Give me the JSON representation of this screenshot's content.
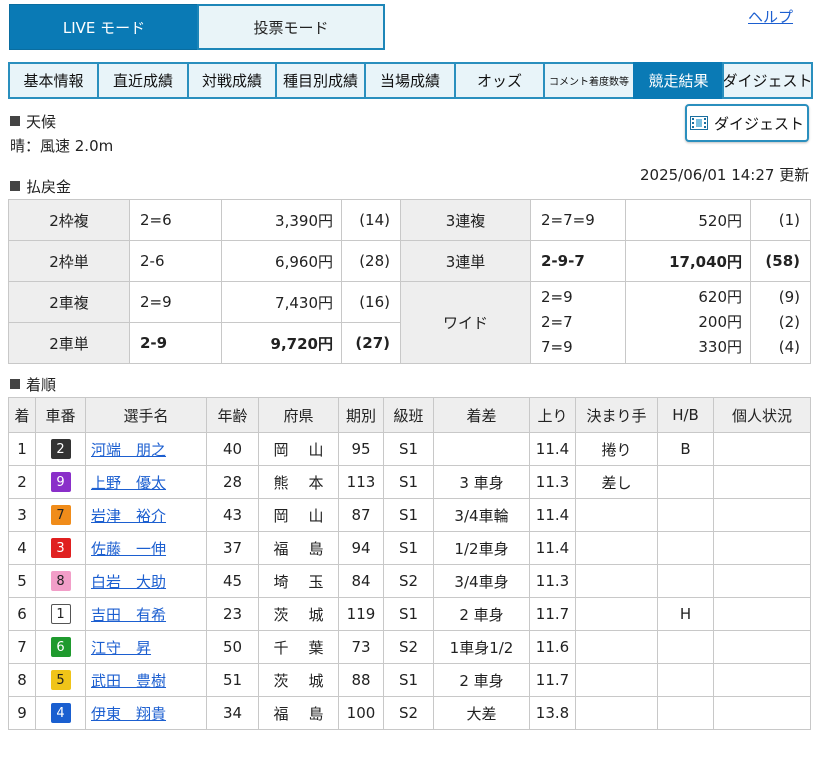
{
  "mode_tabs": {
    "live": "LIVE モード",
    "vote": "投票モード"
  },
  "help": "ヘルプ",
  "nav_tabs": [
    "基本情報",
    "直近成績",
    "対戦成績",
    "種目別成績",
    "当場成績",
    "オッズ",
    "コメント着度数等",
    "競走結果",
    "ダイジェスト"
  ],
  "weather": {
    "title": "天候",
    "text": "晴：風速 2.0m"
  },
  "digest_button": "ダイジェスト",
  "updated": "2025/06/01 14:27 更新",
  "payout": {
    "title": "払戻金",
    "left": [
      {
        "label": "2枠複",
        "combo": "2=6",
        "amount": "3,390円",
        "pop": "(14)"
      },
      {
        "label": "2枠単",
        "combo": "2-6",
        "amount": "6,960円",
        "pop": "(28)"
      },
      {
        "label": "2車複",
        "combo": "2=9",
        "amount": "7,430円",
        "pop": "(16)"
      },
      {
        "label": "2車単",
        "combo": "2-9",
        "amount": "9,720円",
        "pop": "(27)"
      }
    ],
    "right": [
      {
        "label": "3連複",
        "combo": "2=7=9",
        "amount": "520円",
        "pop": "(1)"
      },
      {
        "label": "3連単",
        "combo": "2-9-7",
        "amount": "17,040円",
        "pop": "(58)"
      }
    ],
    "wide": {
      "label": "ワイド",
      "rows": [
        {
          "combo": "2=9",
          "amount": "620円",
          "pop": "(9)"
        },
        {
          "combo": "2=7",
          "amount": "200円",
          "pop": "(2)"
        },
        {
          "combo": "7=9",
          "amount": "330円",
          "pop": "(4)"
        }
      ]
    }
  },
  "results": {
    "title": "着順",
    "headers": [
      "着",
      "車番",
      "選手名",
      "年齢",
      "府県",
      "期別",
      "級班",
      "着差",
      "上り",
      "決まり手",
      "H/B",
      "個人状況"
    ],
    "rows": [
      {
        "rank": "1",
        "car": "2",
        "name": "河端　朋之",
        "age": "40",
        "pref": "岡山",
        "term": "95",
        "class": "S1",
        "margin": "",
        "last": "11.4",
        "kimarite": "捲り",
        "hb": "B",
        "status": ""
      },
      {
        "rank": "2",
        "car": "9",
        "name": "上野　優太",
        "age": "28",
        "pref": "熊本",
        "term": "113",
        "class": "S1",
        "margin": "3 車身",
        "last": "11.3",
        "kimarite": "差し",
        "hb": "",
        "status": ""
      },
      {
        "rank": "3",
        "car": "7",
        "name": "岩津　裕介",
        "age": "43",
        "pref": "岡山",
        "term": "87",
        "class": "S1",
        "margin": "3/4車輪",
        "last": "11.4",
        "kimarite": "",
        "hb": "",
        "status": ""
      },
      {
        "rank": "4",
        "car": "3",
        "name": "佐藤　一伸",
        "age": "37",
        "pref": "福島",
        "term": "94",
        "class": "S1",
        "margin": "1/2車身",
        "last": "11.4",
        "kimarite": "",
        "hb": "",
        "status": ""
      },
      {
        "rank": "5",
        "car": "8",
        "name": "白岩　大助",
        "age": "45",
        "pref": "埼玉",
        "term": "84",
        "class": "S2",
        "margin": "3/4車身",
        "last": "11.3",
        "kimarite": "",
        "hb": "",
        "status": ""
      },
      {
        "rank": "6",
        "car": "1",
        "name": "吉田　有希",
        "age": "23",
        "pref": "茨城",
        "term": "119",
        "class": "S1",
        "margin": "2 車身",
        "last": "11.7",
        "kimarite": "",
        "hb": "H",
        "status": ""
      },
      {
        "rank": "7",
        "car": "6",
        "name": "江守　昇",
        "age": "50",
        "pref": "千葉",
        "term": "73",
        "class": "S2",
        "margin": "1車身1/2",
        "last": "11.6",
        "kimarite": "",
        "hb": "",
        "status": ""
      },
      {
        "rank": "8",
        "car": "5",
        "name": "武田　豊樹",
        "age": "51",
        "pref": "茨城",
        "term": "88",
        "class": "S1",
        "margin": "2 車身",
        "last": "11.7",
        "kimarite": "",
        "hb": "",
        "status": ""
      },
      {
        "rank": "9",
        "car": "4",
        "name": "伊東　翔貴",
        "age": "34",
        "pref": "福島",
        "term": "100",
        "class": "S2",
        "margin": "大差",
        "last": "13.8",
        "kimarite": "",
        "hb": "",
        "status": ""
      }
    ]
  },
  "car_colors": {
    "1": {
      "bg": "#ffffff",
      "fg": "#222222"
    },
    "2": {
      "bg": "#333333",
      "fg": "#ffffff"
    },
    "3": {
      "bg": "#e02020",
      "fg": "#ffffff"
    },
    "4": {
      "bg": "#1a5fd0",
      "fg": "#ffffff"
    },
    "5": {
      "bg": "#f0c419",
      "fg": "#222222"
    },
    "6": {
      "bg": "#1f9a2e",
      "fg": "#ffffff"
    },
    "7": {
      "bg": "#f08c1a",
      "fg": "#222222"
    },
    "8": {
      "bg": "#f29ec8",
      "fg": "#222222"
    },
    "9": {
      "bg": "#8a2fc9",
      "fg": "#ffffff"
    }
  },
  "accent_color": "#0a7ab5"
}
